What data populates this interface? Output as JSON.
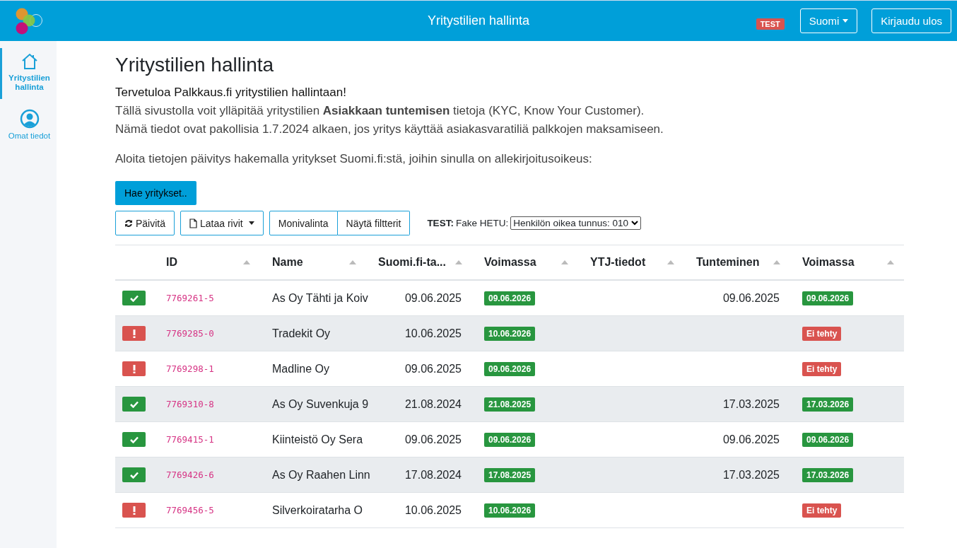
{
  "header": {
    "title": "Yritystilien hallinta",
    "env_badge": "TEST",
    "language": "Suomi",
    "logout": "Kirjaudu ulos"
  },
  "sidebar": {
    "items": [
      {
        "label": "Yritystilien hallinta",
        "selected": true
      },
      {
        "label": "Omat tiedot",
        "selected": false
      }
    ]
  },
  "page": {
    "heading": "Yritystilien hallinta",
    "welcome": "Tervetuloa Palkkaus.fi yritystilien hallintaan!",
    "intro_1": "Tällä sivustolla voit ylläpitää yritystilien **Asiakkaan tuntemisen** tietoja (KYC, Know Your Customer).",
    "intro_2": "Nämä tiedot ovat pakollisia 1.7.2024 alkaen, jos yritys käyttää asiakasvaratiliä palkkojen maksamiseen.",
    "prompt": "Aloita tietojen päivitys hakemalla yritykset Suomi.fi:stä, joihin sinulla on allekirjoitusoikeus:",
    "fetch_button": "Hae yritykset.."
  },
  "toolbar": {
    "refresh": "Päivitä",
    "download": "Lataa rivit",
    "multiselect": "Monivalinta",
    "filters": "Näytä filtterit",
    "test_label": "TEST:",
    "fake_label": "Fake HETU:",
    "fake_select": "Henkilön oikea tunnus: 010"
  },
  "table": {
    "columns": [
      "ID",
      "Name",
      "Suomi.fi-ta...",
      "Voimassa",
      "YTJ-tiedot",
      "Tunteminen",
      "Voimassa"
    ],
    "rows": [
      {
        "kind": "ok",
        "id": "7769261-5",
        "name": "As Oy Tähti ja Koiv",
        "suomifi": "09.06.2025",
        "valid": {
          "text": "09.06.2026",
          "kind": "ok"
        },
        "kyc": "09.06.2025",
        "kyc_valid": {
          "text": "09.06.2026",
          "kind": "ok"
        }
      },
      {
        "kind": "error",
        "id": "7769285-0",
        "name": "Tradekit Oy",
        "suomifi": "10.06.2025",
        "valid": {
          "text": "10.06.2026",
          "kind": "ok"
        },
        "kyc_valid": {
          "text": "Ei tehty",
          "kind": "error"
        }
      },
      {
        "kind": "error",
        "id": "7769298-1",
        "name": "Madline Oy",
        "suomifi": "09.06.2025",
        "valid": {
          "text": "09.06.2026",
          "kind": "ok"
        },
        "kyc_valid": {
          "text": "Ei tehty",
          "kind": "error"
        }
      },
      {
        "kind": "ok",
        "id": "7769310-8",
        "name": "As Oy Suvenkuja 9",
        "suomifi": "21.08.2024",
        "valid": {
          "text": "21.08.2025",
          "kind": "ok"
        },
        "kyc": "17.03.2025",
        "kyc_valid": {
          "text": "17.03.2026",
          "kind": "ok"
        }
      },
      {
        "kind": "ok",
        "id": "7769415-1",
        "name": "Kiinteistö Oy Sera",
        "suomifi": "09.06.2025",
        "valid": {
          "text": "09.06.2026",
          "kind": "ok"
        },
        "kyc": "09.06.2025",
        "kyc_valid": {
          "text": "09.06.2026",
          "kind": "ok"
        }
      },
      {
        "kind": "ok",
        "id": "7769426-6",
        "name": "As Oy Raahen Linn",
        "suomifi": "17.08.2024",
        "valid": {
          "text": "17.08.2025",
          "kind": "ok"
        },
        "kyc": "17.03.2025",
        "kyc_valid": {
          "text": "17.03.2026",
          "kind": "ok"
        }
      },
      {
        "kind": "error",
        "id": "7769456-5",
        "name": "Silverkoiratarha O",
        "suomifi": "10.06.2025",
        "valid": {
          "text": "10.06.2026",
          "kind": "ok"
        },
        "kyc_valid": {
          "text": "Ei tehty",
          "kind": "error"
        }
      }
    ]
  }
}
